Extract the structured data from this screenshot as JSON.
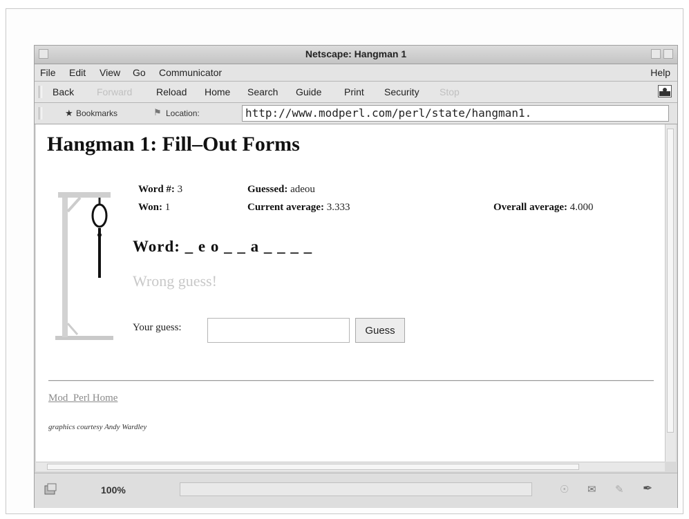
{
  "window": {
    "title": "Netscape: Hangman 1"
  },
  "menubar": {
    "items": [
      "File",
      "Edit",
      "View",
      "Go",
      "Communicator"
    ],
    "help": "Help"
  },
  "toolbar": {
    "buttons": [
      {
        "label": "Back",
        "enabled": true,
        "icon": "back-arrow-icon"
      },
      {
        "label": "Forward",
        "enabled": false,
        "icon": "forward-arrow-icon"
      },
      {
        "label": "Reload",
        "enabled": true,
        "icon": "reload-icon"
      },
      {
        "label": "Home",
        "enabled": true,
        "icon": "home-icon"
      },
      {
        "label": "Search",
        "enabled": true,
        "icon": "search-icon"
      },
      {
        "label": "Guide",
        "enabled": true,
        "icon": "guide-icon"
      },
      {
        "label": "Print",
        "enabled": true,
        "icon": "print-icon"
      },
      {
        "label": "Security",
        "enabled": true,
        "icon": "security-icon"
      },
      {
        "label": "Stop",
        "enabled": false,
        "icon": "stop-icon"
      }
    ]
  },
  "location": {
    "bookmarks_label": "Bookmarks",
    "location_label": "Location:",
    "url": "http://www.modperl.com/perl/state/hangman1."
  },
  "page": {
    "heading": "Hangman 1: Fill–Out Forms",
    "stats": {
      "word_num_label": "Word #:",
      "word_num_value": "3",
      "guessed_label": "Guessed:",
      "guessed_value": "adeou",
      "won_label": "Won:",
      "won_value": "1",
      "current_avg_label": "Current average:",
      "current_avg_value": "3.333",
      "overall_avg_label": "Overall average:",
      "overall_avg_value": "4.000"
    },
    "word_label": "Word:",
    "word_pattern": "_ e o _ _ a _ _ _ _",
    "message": "Wrong guess!",
    "guess_label": "Your guess:",
    "guess_value": "",
    "guess_button": "Guess",
    "home_link": "Mod_Perl Home",
    "credit": "graphics courtesy Andy Wardley"
  },
  "status": {
    "zoom": "100%"
  },
  "colors": {
    "chrome": "#d9d9d9",
    "message": "#c8c8c8",
    "link": "#8a8a8a"
  }
}
